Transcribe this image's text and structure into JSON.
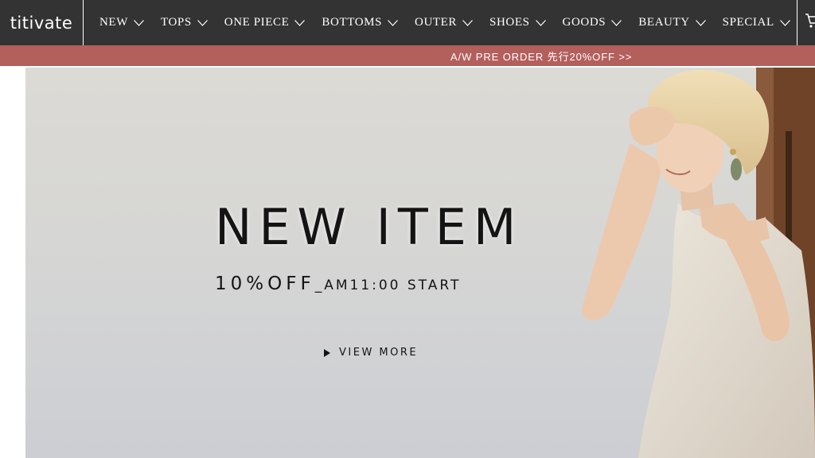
{
  "header": {
    "logo": "titivate",
    "menu": [
      {
        "label": "NEW"
      },
      {
        "label": "TOPS"
      },
      {
        "label": "ONE PIECE"
      },
      {
        "label": "BOTTOMS"
      },
      {
        "label": "OUTER"
      },
      {
        "label": "SHOES"
      },
      {
        "label": "GOODS"
      },
      {
        "label": "BEAUTY"
      },
      {
        "label": "SPECIAL"
      }
    ],
    "cart_icon": "cart-icon"
  },
  "promo": {
    "text": "A/W PRE ORDER 先行20%OFF >>",
    "bg_color": "#b35f5c"
  },
  "hero": {
    "title": "NEW ITEM",
    "subtitle": "10%OFF",
    "subtitle_rest": "_AM11:00 START",
    "cta": "VIEW MORE"
  },
  "colors": {
    "nav_bg": "#333333",
    "text_light": "#ffffff",
    "hero_text": "#141414"
  }
}
